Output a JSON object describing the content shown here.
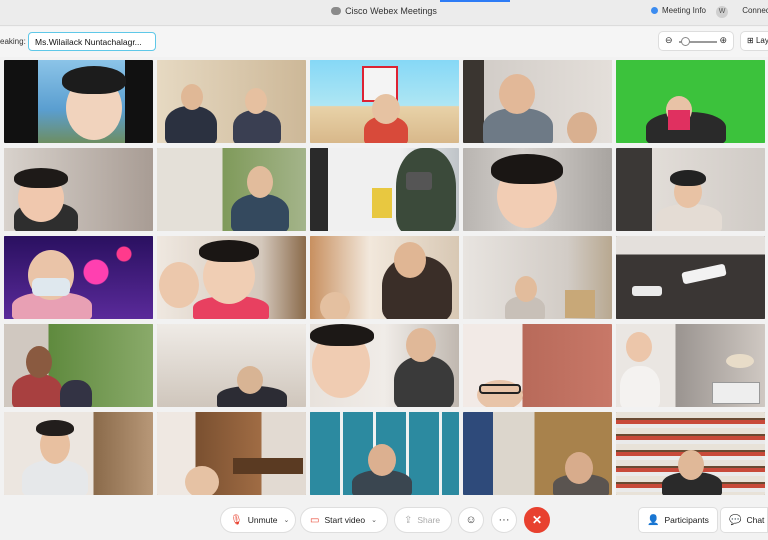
{
  "window": {
    "title": "Cisco Webex Meetings",
    "meeting_info": "Meeting Info",
    "avatar_initial": "W",
    "connect_label": "Connect"
  },
  "speaking": {
    "label": "eaking:",
    "name": "Ms.Wilailack Nuntachalagr..."
  },
  "zoom": {
    "minus": "⊖",
    "plus": "⊕",
    "level": 0.1
  },
  "layout": {
    "label": "Layout"
  },
  "controls": {
    "unmute": "Unmute",
    "start_video": "Start video",
    "share": "Share",
    "participants": "Participants",
    "chat": "Chat"
  },
  "colors": {
    "end_call": "#e8412f",
    "accent": "#2e7cf6",
    "active_speaker_border": "#5fc8e8"
  }
}
